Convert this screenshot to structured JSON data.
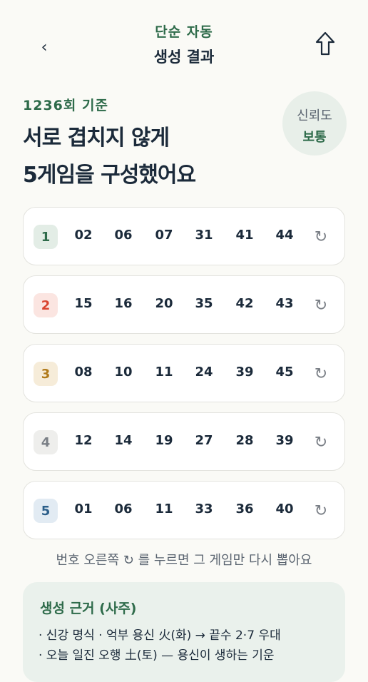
{
  "header": {
    "mode": "단순 자동",
    "title": "생성 결과",
    "back_icon": "chevron-left-icon",
    "share_icon": "share-up-arrow-icon"
  },
  "summary": {
    "round": "1236회 기준",
    "headline_line1": "서로 겹치지 않게",
    "headline_line2": "5게임을 구성했어요",
    "confidence_label": "신뢰도",
    "confidence_value": "보통"
  },
  "games": [
    {
      "index": "1",
      "numbers": [
        "02",
        "06",
        "07",
        "31",
        "41",
        "44"
      ],
      "badge_color": "#2e6b4a",
      "badge_bg": "#e3ede6"
    },
    {
      "index": "2",
      "numbers": [
        "15",
        "16",
        "20",
        "35",
        "42",
        "43"
      ],
      "badge_color": "#d9432f",
      "badge_bg": "#fbe5e1"
    },
    {
      "index": "3",
      "numbers": [
        "08",
        "10",
        "11",
        "24",
        "39",
        "45"
      ],
      "badge_color": "#b07a1a",
      "badge_bg": "#f6ecd9"
    },
    {
      "index": "4",
      "numbers": [
        "12",
        "14",
        "19",
        "27",
        "28",
        "39"
      ],
      "badge_color": "#7a7f86",
      "badge_bg": "#eeeeec"
    },
    {
      "index": "5",
      "numbers": [
        "01",
        "06",
        "11",
        "33",
        "36",
        "40"
      ],
      "badge_color": "#2c5f8a",
      "badge_bg": "#e2ebf3"
    }
  ],
  "reroll_icon": "↻",
  "hint": "번호 오른쪽 ↻ 를 누르면 그 게임만 다시 뽑아요",
  "basis": {
    "title": "생성 근거 (사주)",
    "line1": "· 신강 명식 · 억부 용신 火(화) → 끝수 2·7 우대",
    "line2": "· 오늘 일진 오행 土(토) — 용신이 생하는 기운"
  }
}
